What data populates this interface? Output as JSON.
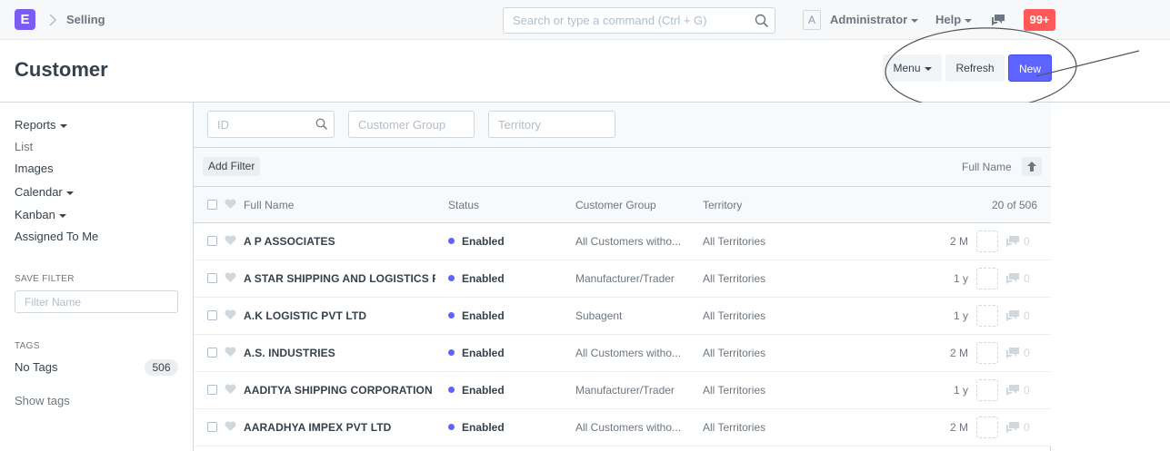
{
  "navbar": {
    "logo_letter": "E",
    "breadcrumb": "Selling",
    "search_placeholder": "Search or type a command (Ctrl + G)",
    "avatar_letter": "A",
    "user": "Administrator",
    "help": "Help",
    "notification_count": "99+"
  },
  "page": {
    "title": "Customer",
    "menu_label": "Menu",
    "refresh_label": "Refresh",
    "new_label": "New"
  },
  "sidebar": {
    "items": [
      "Reports",
      "List",
      "Images",
      "Calendar",
      "Kanban",
      "Assigned To Me"
    ],
    "save_filter_label": "SAVE FILTER",
    "filter_name_placeholder": "Filter Name",
    "tags_label": "TAGS",
    "no_tags": "No Tags",
    "no_tags_count": "506",
    "show_tags": "Show tags"
  },
  "filters": {
    "id_placeholder": "ID",
    "customer_group_placeholder": "Customer Group",
    "territory_placeholder": "Territory",
    "add_filter": "Add Filter",
    "sort_by": "Full Name"
  },
  "list": {
    "columns": {
      "full_name": "Full Name",
      "status": "Status",
      "customer_group": "Customer Group",
      "territory": "Territory",
      "count": "20 of 506"
    },
    "status_color": "#5e64ff",
    "rows": [
      {
        "name": "A P ASSOCIATES",
        "status": "Enabled",
        "group": "All Customers witho...",
        "territory": "All Territories",
        "modified": "2 M",
        "comments": "0"
      },
      {
        "name": "A STAR SHIPPING AND LOGISTICS PVT LTD",
        "status": "Enabled",
        "group": "Manufacturer/Trader",
        "territory": "All Territories",
        "modified": "1 y",
        "comments": "0"
      },
      {
        "name": "A.K LOGISTIC PVT LTD",
        "status": "Enabled",
        "group": "Subagent",
        "territory": "All Territories",
        "modified": "1 y",
        "comments": "0"
      },
      {
        "name": "A.S. INDUSTRIES",
        "status": "Enabled",
        "group": "All Customers witho...",
        "territory": "All Territories",
        "modified": "2 M",
        "comments": "0"
      },
      {
        "name": "AADITYA SHIPPING CORPORATION",
        "status": "Enabled",
        "group": "Manufacturer/Trader",
        "territory": "All Territories",
        "modified": "1 y",
        "comments": "0"
      },
      {
        "name": "AARADHYA IMPEX PVT LTD",
        "status": "Enabled",
        "group": "All Customers witho...",
        "territory": "All Territories",
        "modified": "2 M",
        "comments": "0"
      }
    ]
  }
}
